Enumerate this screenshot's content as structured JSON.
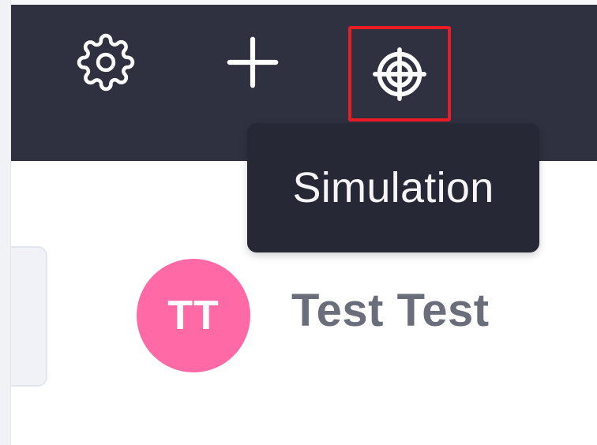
{
  "toolbar": {
    "settings_icon": "gear-icon",
    "add_icon": "plus-icon",
    "simulation_icon": "crosshair-icon",
    "highlight_color": "#ec1c24",
    "bar_color": "#2f3140"
  },
  "tooltip": {
    "text": "Simulation"
  },
  "user": {
    "initials": "TT",
    "name": "Test Test",
    "avatar_color": "#ff69a5"
  }
}
